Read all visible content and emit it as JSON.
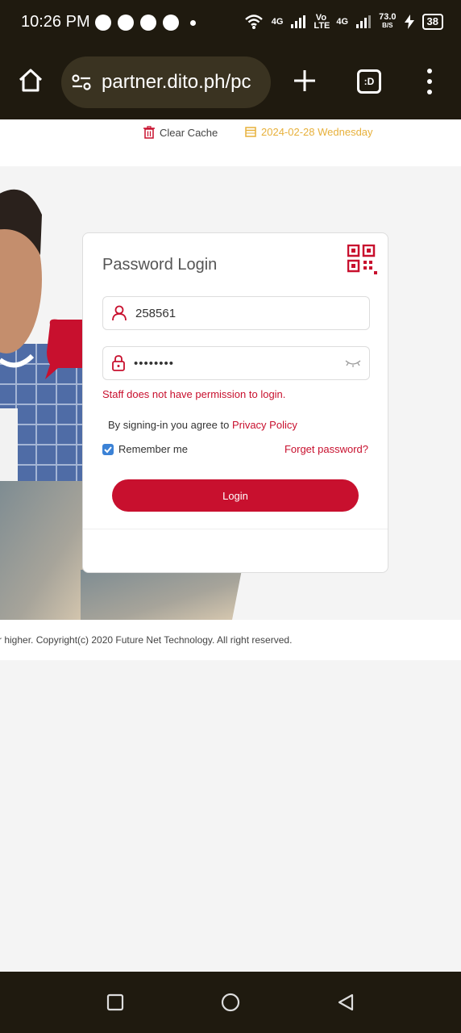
{
  "status_bar": {
    "time": "10:26 PM",
    "network_1": "4G",
    "network_2": "Vo LTE",
    "network_3": "4G",
    "speed_value": "73.0",
    "speed_unit": "B/S",
    "battery": "38"
  },
  "browser": {
    "url": "partner.dito.ph/pc",
    "tabs_label": ":D"
  },
  "site_header": {
    "clear_cache": "Clear Cache",
    "date": "2024-02-28 Wednesday"
  },
  "login": {
    "title": "Password Login",
    "username_value": "258561",
    "password_value": "••••••••",
    "error": "Staff does not have permission to login.",
    "agree_prefix": "By signing-in you agree to",
    "privacy_link": "Privacy Policy",
    "remember_label": "Remember me",
    "remember_checked": true,
    "forget_link": "Forget password?",
    "login_button": "Login"
  },
  "footer": {
    "copyright": "r higher. Copyright(c) 2020 Future Net Technology. All right reserved."
  },
  "colors": {
    "brand_red": "#c8102e",
    "date_yellow": "#e7b03a",
    "browser_dark": "#1f1a0f"
  }
}
